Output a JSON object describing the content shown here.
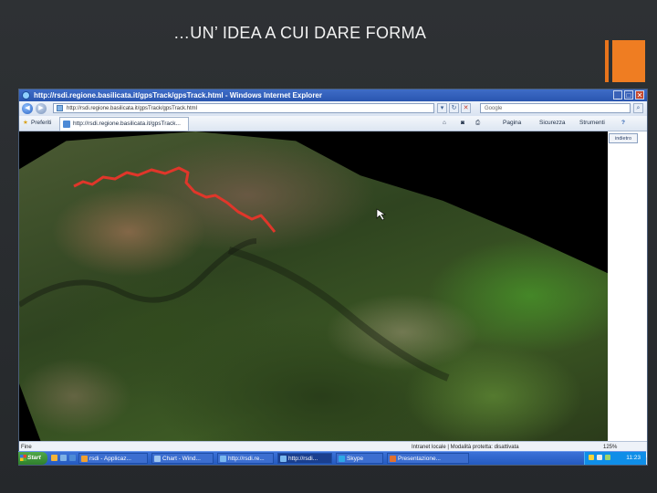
{
  "slide": {
    "title": "…UN’ IDEA A CUI DARE FORMA"
  },
  "window": {
    "title": "http://rsdi.regione.basilicata.it/gpsTrack/gpsTrack.html - Windows Internet Explorer",
    "minimize": "_",
    "maximize": "□",
    "close": "✕"
  },
  "addressbar": {
    "url": "http://rsdi.regione.basilicata.it/gpsTrack/gpsTrack.html",
    "search_placeholder": "Google",
    "back": "◀",
    "forward": "▶"
  },
  "favorites": {
    "label": "Preferiti",
    "tab_label": "http://rsdi.regione.basilicata.it/gpsTrack...",
    "page": "Pagina",
    "safety": "Sicurezza",
    "tools": "Strumenti",
    "help": "?"
  },
  "map": {
    "side_button": "indietro",
    "track_color": "#e0362a",
    "progress_color": "#2fb32f"
  },
  "status": {
    "left": "Fine",
    "zone": "Intranet locale | Modalità protetta: disattivata",
    "zoom": "125%"
  },
  "taskbar": {
    "start": "Start",
    "clock": "11:23",
    "items": [
      {
        "label": "rsdi - Applicaz...",
        "color": "#f0a030"
      },
      {
        "label": "Chart - Wind...",
        "color": "#9fc6f0"
      },
      {
        "label": "http://rsdi.re...",
        "color": "#7ab8ef"
      },
      {
        "label": "http://rsdi...",
        "color": "#7ab8ef"
      },
      {
        "label": "Skype",
        "color": "#2ea8e6"
      },
      {
        "label": "Presentazione...",
        "color": "#e07030"
      }
    ]
  }
}
